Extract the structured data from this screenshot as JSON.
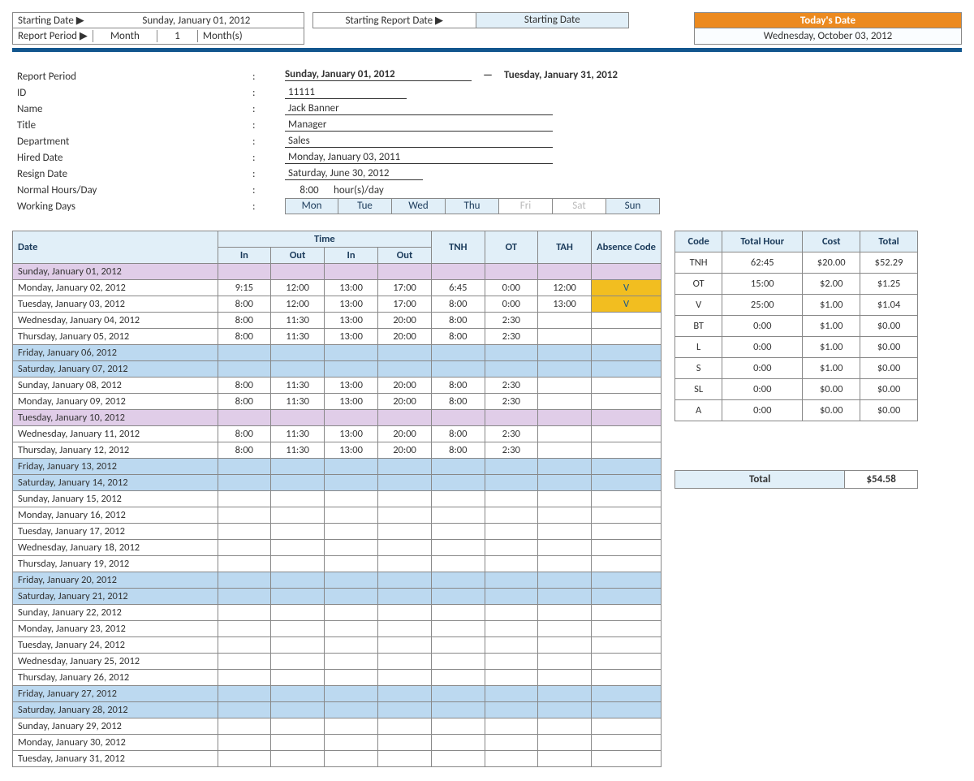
{
  "topbar": {
    "starting_date_label": "Starting Date ▶",
    "starting_date_value": "Sunday, January 01, 2012",
    "report_period_label": "Report Period ▶",
    "report_period_unit": "Month",
    "report_period_count": "1",
    "report_period_suffix": "Month(s)",
    "starting_report_date_label": "Starting Report Date ▶",
    "starting_report_date_value": "Starting Date",
    "today_header": "Today's Date",
    "today_value": "Wednesday, October 03, 2012"
  },
  "employee": {
    "report_period_label": "Report Period",
    "report_from": "Sunday, January 01, 2012",
    "report_dash": "—",
    "report_to": "Tuesday, January 31, 2012",
    "id_label": "ID",
    "id": "11111",
    "name_label": "Name",
    "name": "Jack Banner",
    "title_label": "Title",
    "title": "Manager",
    "department_label": "Department",
    "department": "Sales",
    "hired_label": "Hired Date",
    "hired": "Monday, January 03, 2011",
    "resign_label": "Resign Date",
    "resign": "Saturday, June 30, 2012",
    "hours_label": "Normal Hours/Day",
    "hours_val": "8:00",
    "hours_suffix": "hour(s)/day",
    "wd_label": "Working Days",
    "wd": [
      "Mon",
      "Tue",
      "Wed",
      "Thu",
      "Fri",
      "Sat",
      "Sun"
    ],
    "wd_off": [
      false,
      false,
      false,
      false,
      true,
      true,
      false
    ]
  },
  "headers": {
    "date": "Date",
    "time": "Time",
    "in": "In",
    "out": "Out",
    "tnh": "TNH",
    "ot": "OT",
    "tah": "TAH",
    "absence": "Absence Code"
  },
  "rows": [
    {
      "date": "Sunday, January 01, 2012",
      "style": "purple"
    },
    {
      "date": "Monday, January 02, 2012",
      "in1": "9:15",
      "out1": "12:00",
      "in2": "13:00",
      "out2": "17:00",
      "tnh": "6:45",
      "ot": "0:00",
      "tah": "12:00",
      "abs": "V"
    },
    {
      "date": "Tuesday, January 03, 2012",
      "in1": "8:00",
      "out1": "12:00",
      "in2": "13:00",
      "out2": "17:00",
      "tnh": "8:00",
      "ot": "0:00",
      "tah": "13:00",
      "abs": "V"
    },
    {
      "date": "Wednesday, January 04, 2012",
      "in1": "8:00",
      "out1": "11:30",
      "in2": "13:00",
      "out2": "20:00",
      "tnh": "8:00",
      "ot": "2:30"
    },
    {
      "date": "Thursday, January 05, 2012",
      "in1": "8:00",
      "out1": "11:30",
      "in2": "13:00",
      "out2": "20:00",
      "tnh": "8:00",
      "ot": "2:30"
    },
    {
      "date": "Friday, January 06, 2012",
      "style": "blue"
    },
    {
      "date": "Saturday, January 07, 2012",
      "style": "blue"
    },
    {
      "date": "Sunday, January 08, 2012",
      "in1": "8:00",
      "out1": "11:30",
      "in2": "13:00",
      "out2": "20:00",
      "tnh": "8:00",
      "ot": "2:30"
    },
    {
      "date": "Monday, January 09, 2012",
      "in1": "8:00",
      "out1": "11:30",
      "in2": "13:00",
      "out2": "20:00",
      "tnh": "8:00",
      "ot": "2:30"
    },
    {
      "date": "Tuesday, January 10, 2012",
      "style": "purple"
    },
    {
      "date": "Wednesday, January 11, 2012",
      "in1": "8:00",
      "out1": "11:30",
      "in2": "13:00",
      "out2": "20:00",
      "tnh": "8:00",
      "ot": "2:30"
    },
    {
      "date": "Thursday, January 12, 2012",
      "in1": "8:00",
      "out1": "11:30",
      "in2": "13:00",
      "out2": "20:00",
      "tnh": "8:00",
      "ot": "2:30"
    },
    {
      "date": "Friday, January 13, 2012",
      "style": "blue"
    },
    {
      "date": "Saturday, January 14, 2012",
      "style": "blue"
    },
    {
      "date": "Sunday, January 15, 2012"
    },
    {
      "date": "Monday, January 16, 2012"
    },
    {
      "date": "Tuesday, January 17, 2012"
    },
    {
      "date": "Wednesday, January 18, 2012"
    },
    {
      "date": "Thursday, January 19, 2012"
    },
    {
      "date": "Friday, January 20, 2012",
      "style": "blue"
    },
    {
      "date": "Saturday, January 21, 2012",
      "style": "blue"
    },
    {
      "date": "Sunday, January 22, 2012"
    },
    {
      "date": "Monday, January 23, 2012"
    },
    {
      "date": "Tuesday, January 24, 2012"
    },
    {
      "date": "Wednesday, January 25, 2012"
    },
    {
      "date": "Thursday, January 26, 2012"
    },
    {
      "date": "Friday, January 27, 2012",
      "style": "blue"
    },
    {
      "date": "Saturday, January 28, 2012",
      "style": "blue"
    },
    {
      "date": "Sunday, January 29, 2012"
    },
    {
      "date": "Monday, January 30, 2012"
    },
    {
      "date": "Tuesday, January 31, 2012"
    }
  ],
  "summary": {
    "headers": {
      "code": "Code",
      "hour": "Total Hour",
      "cost": "Cost",
      "total": "Total"
    },
    "rows": [
      {
        "code": "TNH",
        "hour": "62:45",
        "cost": "$20.00",
        "total": "$52.29"
      },
      {
        "code": "OT",
        "hour": "15:00",
        "cost": "$2.00",
        "total": "$1.25"
      },
      {
        "code": "V",
        "hour": "25:00",
        "cost": "$1.00",
        "total": "$1.04"
      },
      {
        "code": "BT",
        "hour": "0:00",
        "cost": "$1.00",
        "total": "$0.00"
      },
      {
        "code": "L",
        "hour": "0:00",
        "cost": "$1.00",
        "total": "$0.00"
      },
      {
        "code": "S",
        "hour": "0:00",
        "cost": "$1.00",
        "total": "$0.00"
      },
      {
        "code": "SL",
        "hour": "0:00",
        "cost": "$0.00",
        "total": "$0.00"
      },
      {
        "code": "A",
        "hour": "0:00",
        "cost": "$0.00",
        "total": "$0.00"
      }
    ],
    "grand_label": "Total",
    "grand_value": "$54.58"
  }
}
